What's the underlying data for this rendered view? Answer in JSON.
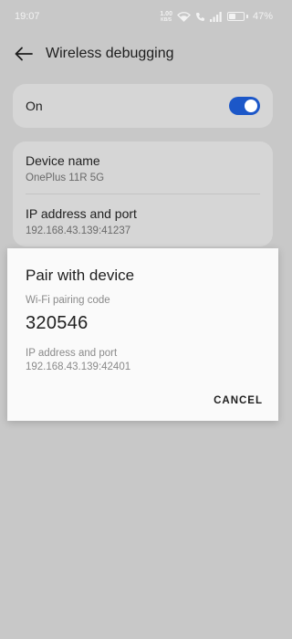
{
  "status_bar": {
    "time": "19:07",
    "net_speed_value": "1.00",
    "net_speed_unit": "KB/S",
    "battery_percent": "47%",
    "battery_level": 0.47,
    "icons": [
      "wifi-icon",
      "call-icon",
      "signal-icon",
      "battery-icon"
    ]
  },
  "header": {
    "back_icon": "back-arrow-icon",
    "title": "Wireless debugging"
  },
  "toggle_card": {
    "label": "On",
    "enabled": true,
    "accent_color": "#1c57c8"
  },
  "info_card": {
    "device_name_label": "Device name",
    "device_name_value": "OnePlus 11R 5G",
    "ip_label": "IP address and port",
    "ip_value": "192.168.43.139:41237"
  },
  "dialog": {
    "title": "Pair with device",
    "code_label": "Wi-Fi pairing code",
    "code": "320546",
    "ip_label": "IP address and port",
    "ip_value": "192.168.43.139:42401",
    "cancel_label": "CANCEL"
  }
}
